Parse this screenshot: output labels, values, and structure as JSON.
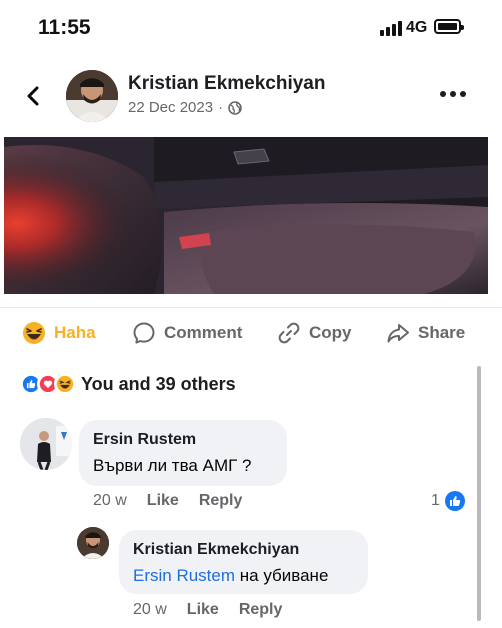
{
  "status_bar": {
    "time": "11:55",
    "network": "4G"
  },
  "post": {
    "author": "Kristian Ekmekchiyan",
    "date": "22 Dec 2023",
    "meta_separator": "·",
    "visibility_icon": "globe-icon"
  },
  "actions": [
    {
      "label": "Haha",
      "icon": "haha-emoji-icon"
    },
    {
      "label": "Comment",
      "icon": "comment-icon"
    },
    {
      "label": "Copy",
      "icon": "link-icon"
    },
    {
      "label": "Share",
      "icon": "share-arrow-icon"
    }
  ],
  "reactions": {
    "icons": [
      "like-reaction-icon",
      "love-reaction-icon",
      "haha-reaction-icon"
    ],
    "summary": "You and 39 others"
  },
  "comments": [
    {
      "author": "Ersin Rustem",
      "text": "Върви ли тва АМГ ?",
      "age": "20 w",
      "like": "Like",
      "reply": "Reply",
      "like_count": "1"
    },
    {
      "author": "Kristian Ekmekchiyan",
      "mention": "Ersin Rustem",
      "text": "на убиване",
      "age": "20 w",
      "like": "Like",
      "reply": "Reply"
    }
  ],
  "colors": {
    "haha_accent": "#f7b125",
    "like_blue": "#1877f2",
    "love_red": "#f33e58",
    "meta_gray": "#65676b",
    "mention_blue": "#216fdb",
    "bubble_bg": "#f0f2f5"
  }
}
